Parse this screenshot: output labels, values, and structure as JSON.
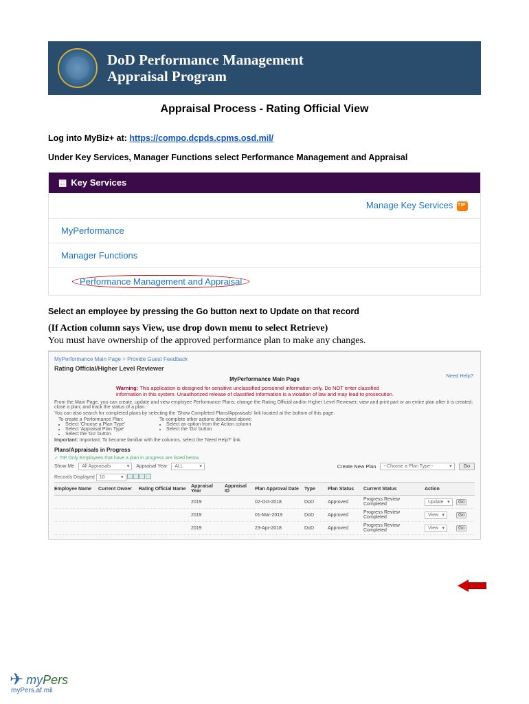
{
  "banner": {
    "line1": "DoD Performance Management",
    "line2": "Appraisal Program"
  },
  "title": "Appraisal Process - Rating Official View",
  "login_prefix": "Log into MyBiz+ at: ",
  "login_url": "https://compo.dcpds.cpms.osd.mil/",
  "step1": "Under Key Services, Manager Functions select Performance Management and Appraisal",
  "ks": {
    "header": "Key Services",
    "manage": "Manage Key Services",
    "rows": [
      "MyPerformance",
      "Manager Functions",
      "Performance Management and Appraisal"
    ]
  },
  "step2": "Select an employee by pressing the Go button next to Update on that record",
  "note_bold": "(If Action column says View, use drop down menu to select Retrieve)",
  "note_plain": "You must have ownership of the approved performance plan to make any changes.",
  "app": {
    "breadcrumb": {
      "a": "MyPerformance Main Page",
      "sep": ">",
      "b": "Provide Guest Feedback"
    },
    "tab": "Rating Official/Higher Level Reviewer",
    "main_head": "MyPerformance Main Page",
    "help": "Need Help?",
    "warning_label": "Warning:",
    "warning_text": "This application is designed for sensitive unclassified personnel information only. Do NOT enter classified information in this system. Unauthorized release of classified information is a violation of law and may lead to prosecution.",
    "intro": "From the Main Page, you can create, update and view employee Performance Plans; change the Rating Official and/or Higher Level Reviewer; view and print part or an entire plan after it is created; close a plan; and track the status of a plan.",
    "intro2": "You can also search for completed plans by selecting the 'Show Completed Plans/Appraisals' link located at the bottom of this page.",
    "create_head": "To create a Performance Plan:",
    "complete_head": "To complete other actions described above:",
    "bullets_left": [
      "Select 'Choose a Plan Type'",
      "Select 'Appraisal Plan Type'",
      "Select the 'Go' button"
    ],
    "bullets_right": [
      "Select an option from the Action column",
      "Select the 'Go' button"
    ],
    "important": "Important: To become familiar with the columns, select the 'Need Help?' link.",
    "section": "Plans/Appraisals in Progress",
    "tip": "TIP Only Employees that have a plan in progress are listed below.",
    "show_me": "Show Me",
    "show_me_val": "All Appraisals",
    "apr_year_lbl": "Appraisal Year",
    "apr_year_val": "ALL",
    "create_new": "Create New Plan",
    "plan_type_ph": "--Choose a Plan Type--",
    "go": "Go",
    "records": "Records Displayed",
    "records_val": "10",
    "cols": [
      "Employee Name",
      "Current Owner",
      "Rating Official Name",
      "Appraisal Year",
      "Appraisal ID",
      "Plan Approval Date",
      "Type",
      "Plan Status",
      "Current Status",
      "Action",
      ""
    ],
    "rows": [
      {
        "year": "2019",
        "date": "02-Oct-2018",
        "type": "DoD",
        "pstatus": "Approved",
        "cstatus": "Progress Review Completed",
        "action": "Update"
      },
      {
        "year": "2019",
        "date": "01-Mar-2019",
        "type": "DoD",
        "pstatus": "Approved",
        "cstatus": "Progress Review Completed",
        "action": "View"
      },
      {
        "year": "2019",
        "date": "23-Apr-2018",
        "type": "DoD",
        "pstatus": "Approved",
        "cstatus": "Progress Review Completed",
        "action": "View"
      }
    ]
  },
  "footer": {
    "my": "my",
    "pers": "Pers",
    "url": "myPers.af.mil"
  }
}
